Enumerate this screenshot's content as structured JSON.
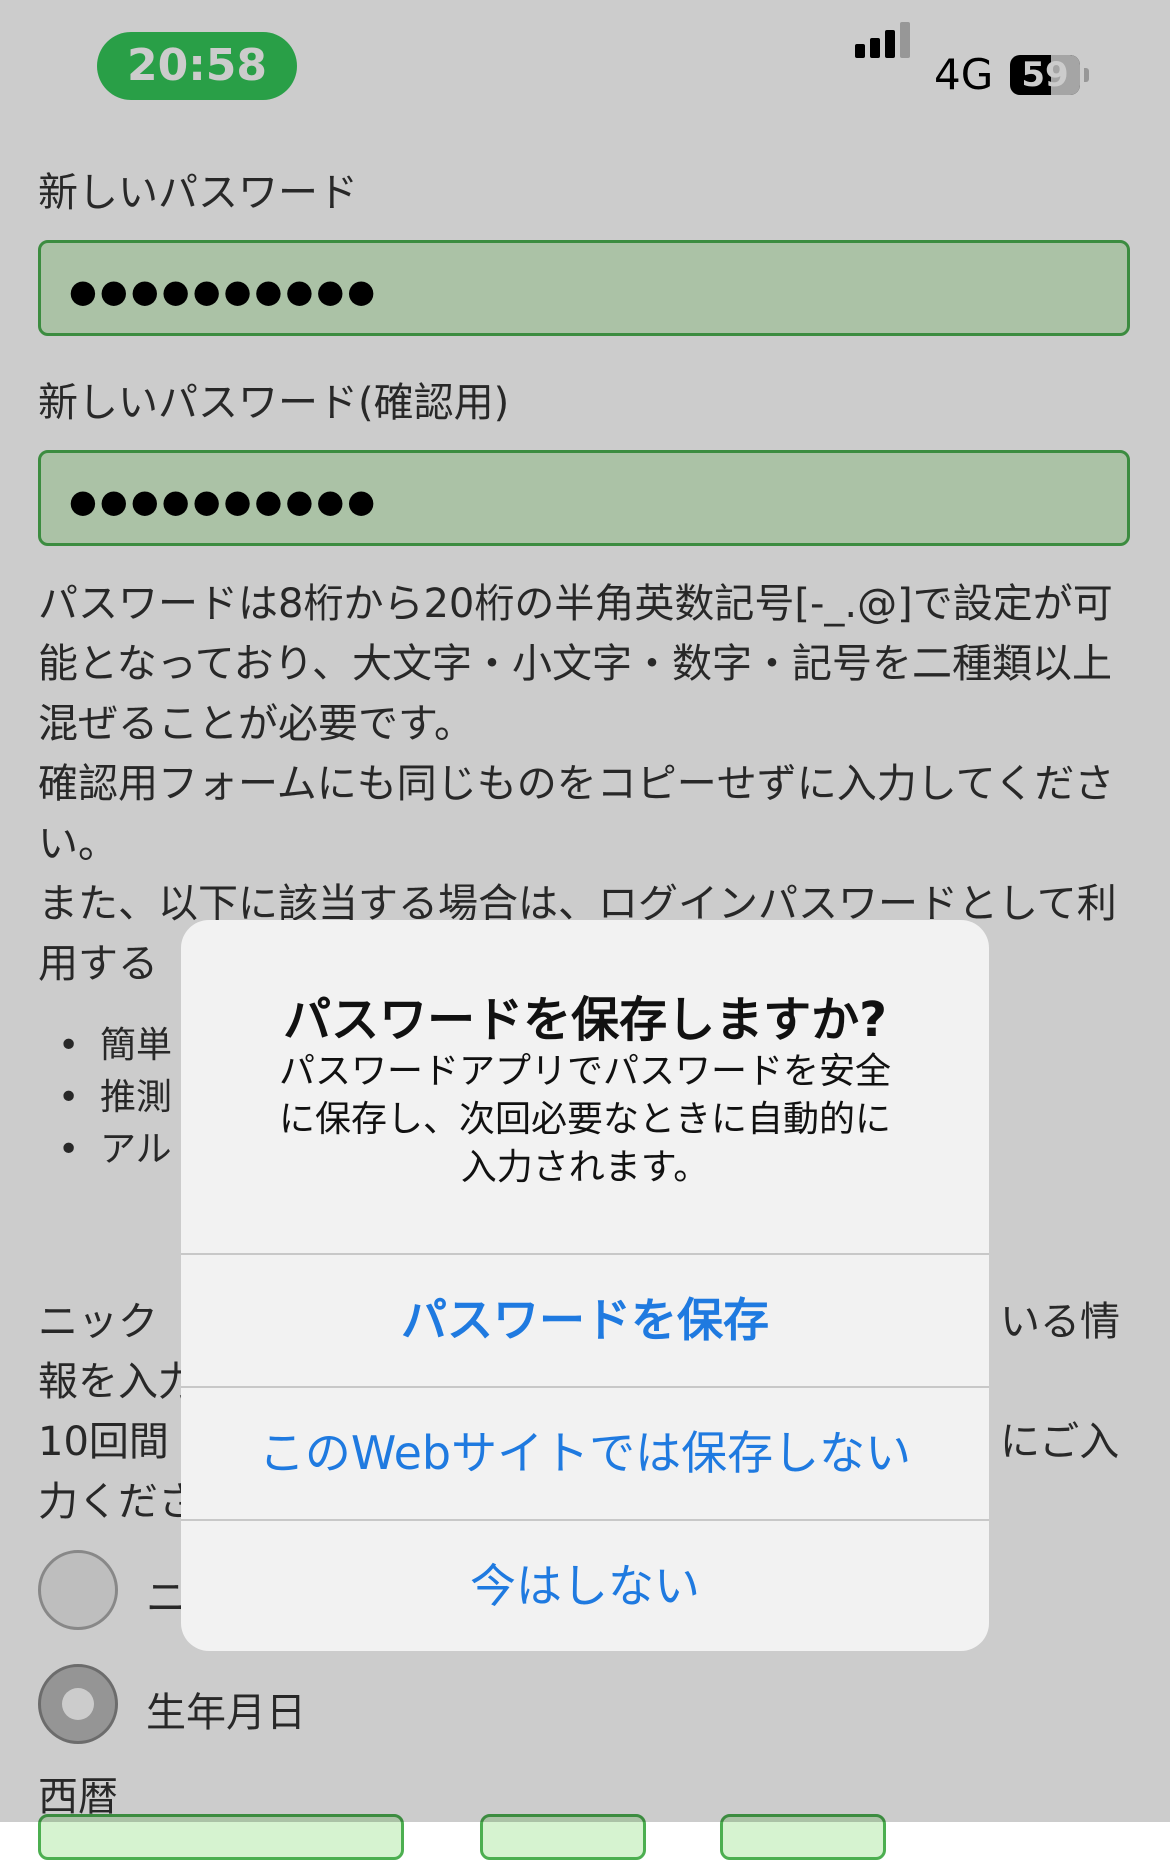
{
  "status_bar": {
    "time": "20:58",
    "network": "4G",
    "battery": "59",
    "battery_level": 0.59
  },
  "form": {
    "new_password_label": "新しいパスワード",
    "new_password_value": "●●●●●●●●●●",
    "confirm_password_label": "新しいパスワード(確認用)",
    "confirm_password_value": "●●●●●●●●●●",
    "rules_text_1": "パスワードは8桁から20桁の半角英数記号[-_.@]で設定が可能となっており、大文字・小文字・数字・記号を二種類以上混ぜることが必要です。",
    "rules_text_2": "確認用フォームにも同じものをコピーせずに入力してください。",
    "rules_text_3": "また、以下に該当する場合は、ログインパスワードとして利用する",
    "bullets": [
      "簡単",
      "推測",
      "アル"
    ],
    "nickname_text_1": "ニック",
    "nickname_text_1_end": "いる情",
    "nickname_text_2": "報を入力",
    "nickname_text_3": "10回間",
    "nickname_text_3_end": "にご入",
    "nickname_text_4": "力くださ",
    "radio_option_1": "ニ",
    "radio_option_2": "生年月日",
    "calendar_label": "西暦"
  },
  "alert": {
    "title": "パスワードを保存しますか?",
    "message": "パスワードアプリでパスワードを安全に保存し、次回必要なときに自動的に入力されます。",
    "save_button": "パスワードを保存",
    "never_button": "このWebサイトでは保存しない",
    "not_now_button": "今はしない"
  }
}
